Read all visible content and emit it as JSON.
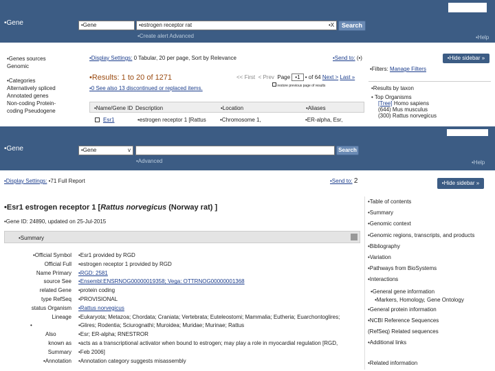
{
  "top": {
    "db_label": "•Gene",
    "db_select": "•Gene",
    "search_value": "•estrogen receptor rat",
    "clear": "•X",
    "search_btn": "Search",
    "create_alert": "•Create alert",
    "advanced": "Advanced",
    "help": "•Help",
    "sidebar_sources": "•Genes sources Genomic",
    "sidebar_categories": "•Categories Alternatively spliced Annotated genes Non-coding Protein-coding Pseudogene",
    "display_settings_label": "•Display Settings:",
    "display_settings_value": "0 Tabular, 20 per page, Sort by Relevance",
    "send_to": "•Send to:",
    "send_to_icon": "(•)",
    "hide_sidebar": "•Hide sidebar »",
    "filters_label": "•Filters:",
    "filters_link": "Manage Filters",
    "results": "•Results: 1 to 20 of 1271",
    "first": "<< First",
    "prev": "< Prev",
    "page_label": "Page",
    "page_value": "•1",
    "of_pages": "• of 64",
    "next": "Next >",
    "last": "Last »",
    "see_also": "•0 See also 13 discontinued or replaced items.",
    "restore_note": "restore previous page of results",
    "results_by_taxon": "•Results by taxon",
    "top_organisms_label": "•  Top Organisms",
    "taxa": [
      {
        "count": "[Tree]",
        "name": "Homo sapiens"
      },
      {
        "count": "(644)",
        "name": "Mus musculus"
      },
      {
        "count": "(300)",
        "name": "Rattus norvegicus"
      }
    ],
    "table_headers": [
      "•Name/Gene ID",
      "Description",
      "•Location",
      "•Aliases"
    ],
    "row": {
      "name": "Esr1",
      "description": "•estrogen receptor 1 [Rattus",
      "location": "•Chromosome 1,",
      "aliases": "•ER-alpha, Esr,"
    }
  },
  "bottom": {
    "db_label": "•Gene",
    "db_select": "•Gene",
    "search_btn": "Search",
    "advanced": "•Advanced",
    "help": "•Help",
    "display_settings_label": "•Display Settings:",
    "display_settings_value": "•71 Full Report",
    "send_to": "•Send to:",
    "send_to_icon": "2",
    "hide_sidebar": "•Hide sidebar »",
    "gene_title_prefix": "•Esr1 estrogen receptor 1 [",
    "gene_title_species": "Rattus norvegicus",
    "gene_title_suffix": " (Norway rat) ]",
    "gene_id": "•Gene ID: 24890, updated on 25-Jul-2015",
    "summary_header": "•Summary",
    "labels": [
      "•Official Symbol",
      "Official Full",
      "Name Primary",
      "source See",
      "related Gene",
      "type RefSeq",
      "status Organism",
      "Lineage",
      "•",
      "Also",
      "known as",
      "Summary",
      "•Annotation"
    ],
    "values": [
      "•Esr1 provided by RGD",
      "•estrogen receptor 1 provided by RGD",
      "•RGD: 2581",
      "•Ensembl:ENSRNOG00000019358; Vega: OTTRNOG00000001368",
      "•protein coding",
      "•PROVISIONAL",
      "•Rattus norvegicus",
      "•Eukaryota; Metazoa; Chordata; Craniata; Vertebrata; Euteleostomi; Mammalia; Eutheria; Euarchontoglires;",
      "•Glires; Rodentia; Sciurognathi; Muroidea; Muridae; Murinae; Rattus",
      "•Esr; ER-alpha; RNESTROR",
      "•acts as a transcriptional activator when bound to estrogen; may play a role in myocardial regulation [RGD,",
      "•Feb 2006]",
      "•Annotation category suggests misassembly"
    ],
    "toc": [
      "•Table of contents",
      "•Summary",
      "•Genomic context",
      "•Genomic regions, transcripts, and products",
      "•Bibliography",
      "•Variation",
      "•Pathways from BioSystems",
      "•Interactions",
      "•General gene information",
      "•Markers, Homology, Gene Ontology",
      "•General protein information",
      "•NCBI Reference Sequences",
      "(RefSeq) Related sequences",
      "•Additional links",
      "•Related information"
    ]
  }
}
